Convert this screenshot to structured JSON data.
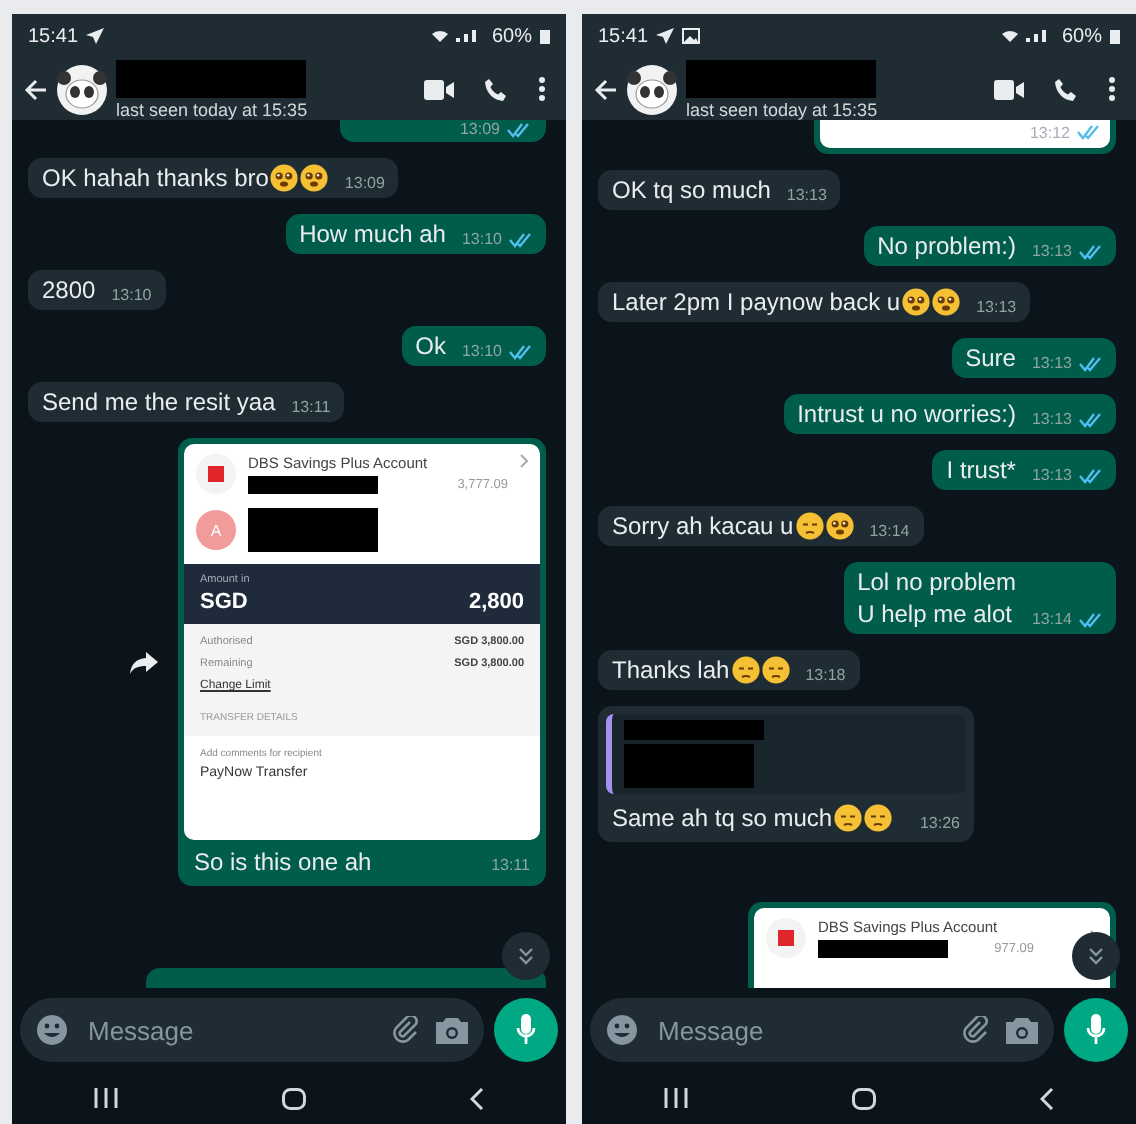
{
  "phones": [
    {
      "status_bar": {
        "time": "15:41",
        "gallery_notification": false,
        "battery": "60%"
      },
      "header": {
        "last_seen": "last seen today at 15:35"
      },
      "messages": [
        {
          "kind": "partial-top",
          "outgoing": true,
          "time": "13:09",
          "read": true
        },
        {
          "kind": "text",
          "outgoing": false,
          "text": "OK hahah thanks bro",
          "emojis": [
            {
              "kind": "teary"
            },
            {
              "kind": "teary"
            }
          ],
          "time": "13:09"
        },
        {
          "kind": "text",
          "outgoing": true,
          "text": "How much ah",
          "time": "13:10",
          "read": true
        },
        {
          "kind": "text",
          "outgoing": false,
          "text": "2800",
          "time": "13:10"
        },
        {
          "kind": "text",
          "outgoing": true,
          "text": "Ok",
          "time": "13:10",
          "read": true
        },
        {
          "kind": "text",
          "outgoing": false,
          "text": "Send me the resit yaa",
          "time": "13:11"
        },
        {
          "kind": "receipt",
          "outgoing": true,
          "account": "DBS Savings Plus Account",
          "balance": "3,777.09",
          "avatar_letter": "A",
          "amount_label": "Amount in",
          "currency": "SGD",
          "amount": "2,800",
          "rows": [
            {
              "label": "Authorised",
              "value": "SGD 3,800.00"
            },
            {
              "label": "Remaining",
              "value": "SGD 3,800.00"
            }
          ],
          "link": "Change Limit",
          "section": "TRANSFER DETAILS",
          "comment_label": "Add comments for recipient",
          "comment": "PayNow Transfer",
          "caption": "So is this one ah",
          "time": "13:11"
        },
        {
          "kind": "partial-bottom",
          "outgoing": true
        }
      ],
      "composer": {
        "placeholder": "Message"
      }
    },
    {
      "status_bar": {
        "time": "15:41",
        "gallery_notification": true,
        "battery": "60%"
      },
      "header": {
        "last_seen": "last seen today at 15:35"
      },
      "messages": [
        {
          "kind": "partial-receipt-bottom",
          "outgoing": true,
          "time": "13:12",
          "read": true
        },
        {
          "kind": "text",
          "outgoing": false,
          "text": "OK tq so much",
          "time": "13:13"
        },
        {
          "kind": "text",
          "outgoing": true,
          "text": "No problem:)",
          "time": "13:13",
          "read": true
        },
        {
          "kind": "text",
          "outgoing": false,
          "text": "Later 2pm I paynow back u",
          "emojis": [
            {
              "kind": "teary"
            },
            {
              "kind": "teary"
            }
          ],
          "time": "13:13"
        },
        {
          "kind": "text",
          "outgoing": true,
          "text": "Sure",
          "time": "13:13",
          "read": true
        },
        {
          "kind": "text",
          "outgoing": true,
          "text": "Intrust u no worries:)",
          "time": "13:13",
          "read": true
        },
        {
          "kind": "text",
          "outgoing": true,
          "text": "I trust*",
          "time": "13:13",
          "read": true
        },
        {
          "kind": "text",
          "outgoing": false,
          "text": "Sorry ah kacau u",
          "emojis": [
            {
              "kind": "pensive"
            },
            {
              "kind": "teary"
            }
          ],
          "time": "13:14"
        },
        {
          "kind": "text",
          "outgoing": true,
          "text": "Lol no problem\nU help me alot",
          "time": "13:14",
          "read": true
        },
        {
          "kind": "text",
          "outgoing": false,
          "text": "Thanks lah",
          "emojis": [
            {
              "kind": "pensive"
            },
            {
              "kind": "pensive"
            }
          ],
          "time": "13:18"
        },
        {
          "kind": "quote",
          "outgoing": false,
          "text": "Same ah tq so much",
          "emojis": [
            {
              "kind": "pensive"
            },
            {
              "kind": "pensive"
            }
          ],
          "time": "13:26"
        },
        {
          "kind": "receipt-top",
          "outgoing": true,
          "account": "DBS Savings Plus Account",
          "balance": "977.09"
        }
      ],
      "composer": {
        "placeholder": "Message"
      }
    }
  ]
}
